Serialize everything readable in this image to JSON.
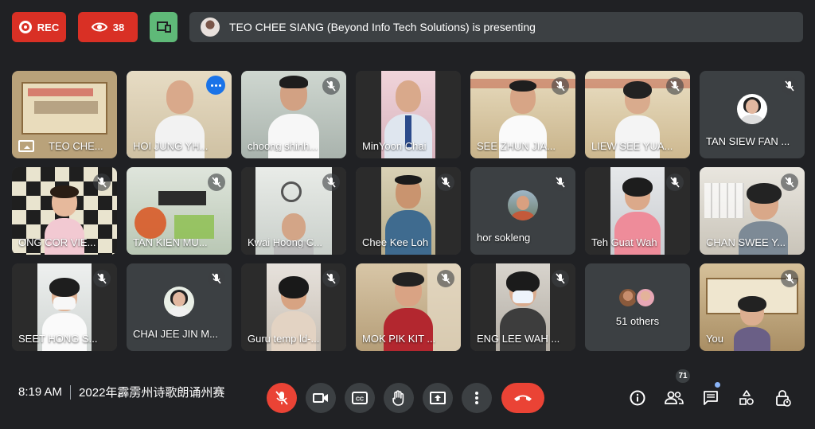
{
  "top": {
    "rec_label": "REC",
    "viewer_count": "38",
    "banner_text": "TEO CHEE SIANG (Beyond Info Tech Solutions) is presenting"
  },
  "tiles": [
    {
      "name": "TEO CHE...",
      "type": "presenting"
    },
    {
      "name": "HOI JUNG YH...",
      "type": "video",
      "active": true
    },
    {
      "name": "choong shinh...",
      "type": "video"
    },
    {
      "name": "MinYoon Chai",
      "type": "video"
    },
    {
      "name": "SEE ZHUN JIA...",
      "type": "video"
    },
    {
      "name": "LIEW SEE YUA...",
      "type": "video"
    },
    {
      "name": "TAN SIEW FAN ...",
      "type": "avatar"
    },
    {
      "name": "ONG COR VIE...",
      "type": "video"
    },
    {
      "name": "TAN KIEN MU...",
      "type": "video"
    },
    {
      "name": "Kwai Hoong C...",
      "type": "video"
    },
    {
      "name": "Chee Kee Loh",
      "type": "video"
    },
    {
      "name": "hor sokleng",
      "type": "avatar"
    },
    {
      "name": "Teh Guat Wah",
      "type": "video"
    },
    {
      "name": "CHAN SWEE Y...",
      "type": "video"
    },
    {
      "name": "SEET HONG S...",
      "type": "video"
    },
    {
      "name": "CHAI JEE JIN M...",
      "type": "avatar"
    },
    {
      "name": "Guru temp ld-...",
      "type": "video"
    },
    {
      "name": "MOK PIK KIT ...",
      "type": "video"
    },
    {
      "name": "ENG LEE WAH ...",
      "type": "video"
    },
    {
      "name": "51 others",
      "type": "others"
    },
    {
      "name": "You",
      "type": "video"
    }
  ],
  "bottom": {
    "time": "8:19 AM",
    "meeting_title": "2022年霹雳州诗歌朗诵州赛",
    "participants_badge": "71"
  },
  "icons": {
    "record": "record-dot-icon",
    "viewers": "eye-icon",
    "present": "present-screen-icon",
    "mic_off": "mic-off-icon",
    "camera": "videocam-icon",
    "captions": "closed-captions-icon",
    "raise_hand": "raise-hand-icon",
    "present_now": "present-now-icon",
    "more": "more-vert-icon",
    "hangup": "call-end-icon",
    "info": "info-icon",
    "people": "people-icon",
    "chat": "chat-icon",
    "activities": "activities-icon",
    "host_controls": "host-lock-icon"
  },
  "colors": {
    "background": "#202124",
    "tile": "#3c4043",
    "danger": "#ea4335",
    "rec_red": "#d93025",
    "present_green": "#5fb978",
    "active_outline": "#8ab4f8"
  }
}
